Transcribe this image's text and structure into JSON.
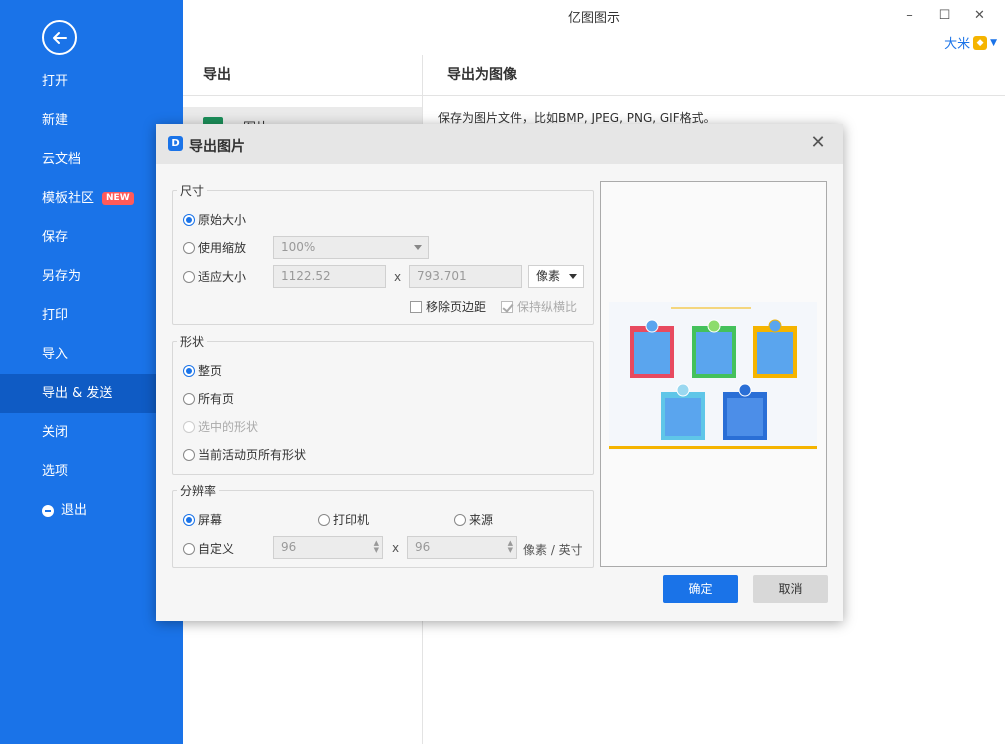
{
  "app": {
    "title": "亿图图示",
    "user_name": "大米"
  },
  "sidebar": {
    "items": [
      {
        "label": "打开"
      },
      {
        "label": "新建"
      },
      {
        "label": "云文档"
      },
      {
        "label": "模板社区",
        "badge": "NEW"
      },
      {
        "label": "保存"
      },
      {
        "label": "另存为"
      },
      {
        "label": "打印"
      },
      {
        "label": "导入"
      },
      {
        "label": "导出 & 发送",
        "active": true
      },
      {
        "label": "关闭"
      },
      {
        "label": "选项"
      },
      {
        "label": "退出"
      }
    ]
  },
  "export": {
    "left_title": "导出",
    "left_item": "图片",
    "right_title": "导出为图像",
    "description": "保存为图片文件，比如BMP, JPEG, PNG, GIF格式。"
  },
  "dialog": {
    "title": "导出图片",
    "size": {
      "legend": "尺寸",
      "original_label": "原始大小",
      "scale_label": "使用缩放",
      "scale_value": "100%",
      "fit_label": "适应大小",
      "width": "1122.52",
      "x_sep": "x",
      "height": "793.701",
      "unit": "像素",
      "remove_margin_label": "移除页边距",
      "keep_ratio_label": "保持纵横比"
    },
    "shape": {
      "legend": "形状",
      "whole_page": "整页",
      "all_pages": "所有页",
      "selected_shapes": "选中的形状",
      "active_page_shapes": "当前活动页所有形状"
    },
    "resolution": {
      "legend": "分辨率",
      "screen": "屏幕",
      "printer": "打印机",
      "source": "来源",
      "custom": "自定义",
      "dpi_x": "96",
      "x_sep": "x",
      "dpi_y": "96",
      "unit": "像素 / 英寸"
    },
    "ok_label": "确定",
    "cancel_label": "取消"
  },
  "colors": {
    "sidebar": "#1a73e8",
    "sidebar_active": "#0f5bc4",
    "badge": "#ff5a5a",
    "ok_button": "#1a73e8"
  }
}
